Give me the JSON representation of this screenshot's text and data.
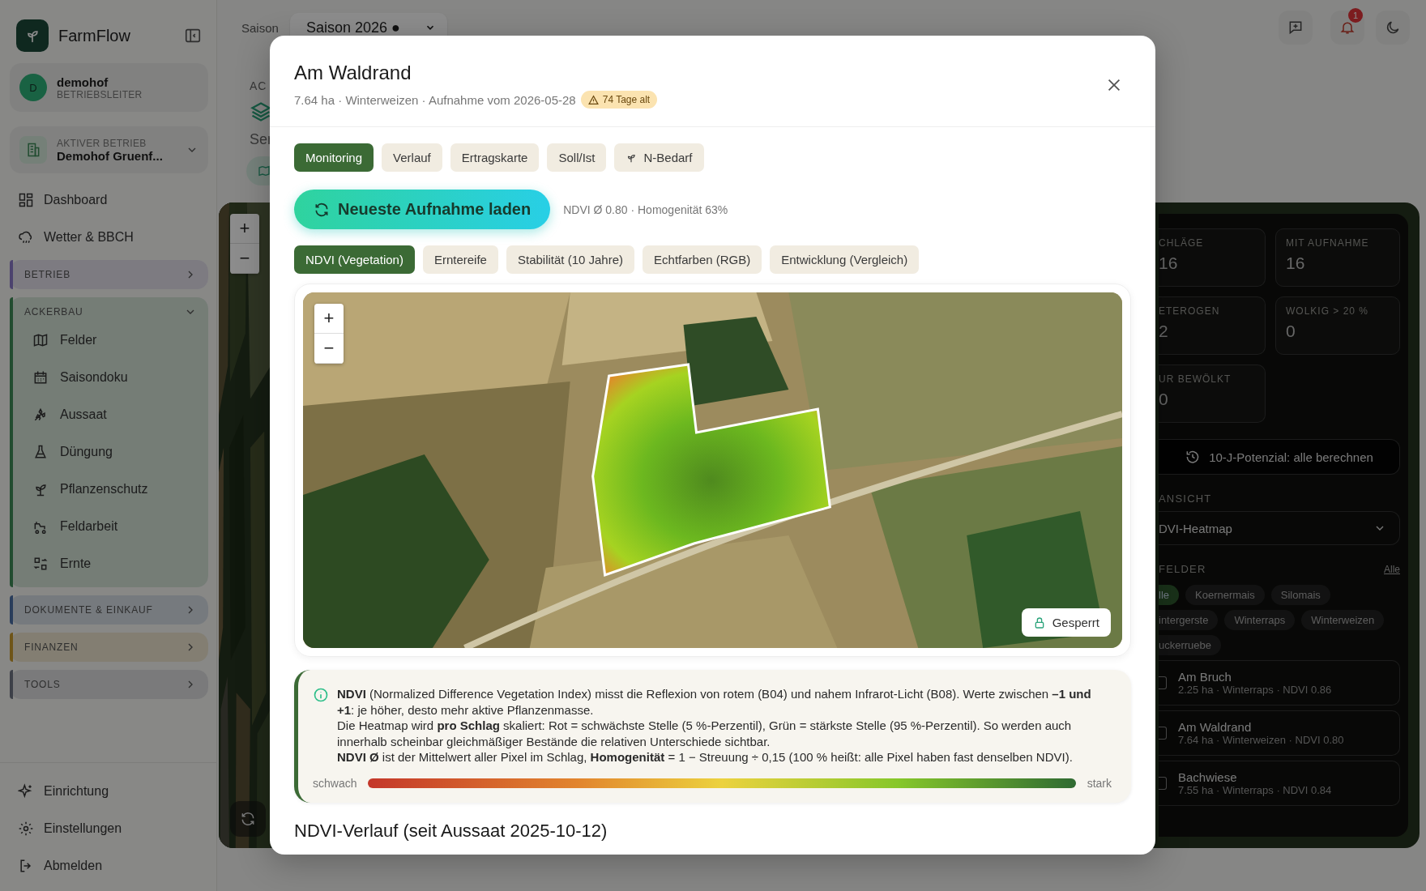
{
  "sidebar": {
    "brand": "FarmFlow",
    "user": {
      "initial": "D",
      "name": "demohof",
      "role": "BETRIEBSLEITER"
    },
    "company": {
      "label": "AKTIVER BETRIEB",
      "name": "Demohof Gruenf..."
    },
    "top_items": [
      {
        "label": "Dashboard"
      },
      {
        "label": "Wetter & BBCH"
      }
    ],
    "groups": [
      {
        "label": "BETRIEB",
        "color": "#4c426e",
        "expanded": false
      },
      {
        "label": "ACKERBAU",
        "color": "#224c30",
        "expanded": true,
        "children": [
          {
            "label": "Felder"
          },
          {
            "label": "Saisondoku"
          },
          {
            "label": "Aussaat"
          },
          {
            "label": "Düngung"
          },
          {
            "label": "Pflanzenschutz"
          },
          {
            "label": "Feldarbeit"
          },
          {
            "label": "Ernte"
          }
        ]
      },
      {
        "label": "DOKUMENTE & EINKAUF",
        "color": "#2a3d5c",
        "expanded": false
      },
      {
        "label": "FINANZEN",
        "color": "#6f5519",
        "expanded": false
      },
      {
        "label": "TOOLS",
        "color": "#3d4148",
        "expanded": false
      }
    ],
    "bottom_items": [
      {
        "label": "Einrichtung"
      },
      {
        "label": "Einstellungen"
      },
      {
        "label": "Abmelden"
      }
    ]
  },
  "topbar": {
    "season_label": "Saison",
    "season_value": "Saison 2026 ●",
    "notification_count": "1"
  },
  "page": {
    "section_label": "AC",
    "subtitle": "Ser"
  },
  "background_map": {
    "zoom_in": "+",
    "zoom_out": "−"
  },
  "map_panel": {
    "stats": [
      {
        "label": "CHLÄGE",
        "value": "16"
      },
      {
        "label": "MIT AUFNAHME",
        "value": "16"
      },
      {
        "label": "ETEROGEN",
        "value": "2"
      },
      {
        "label": "WOLKIG > 20 %",
        "value": "0"
      },
      {
        "label": "UR BEWÖLKT",
        "value": "0"
      }
    ],
    "potential_button": "10-J-Potenzial: alle berechnen",
    "view_label": "ANSICHT",
    "view_value": "DVI-Heatmap",
    "fields_label": "FELDER",
    "all_link": "Alle",
    "chips": [
      {
        "label": "lle",
        "selected": true
      },
      {
        "label": "Koernermais",
        "selected": false
      },
      {
        "label": "Silomais",
        "selected": false
      },
      {
        "label": "intergerste",
        "selected": false
      },
      {
        "label": "Winterraps",
        "selected": false
      },
      {
        "label": "Winterweizen",
        "selected": false
      },
      {
        "label": "uckerruebe",
        "selected": false
      }
    ],
    "fields": [
      {
        "name": "Am Bruch",
        "meta": "2.25 ha · Winterraps · NDVI 0.86",
        "checked": false
      },
      {
        "name": "Am Waldrand",
        "meta": "7.64 ha · Winterweizen · NDVI 0.80",
        "checked": false
      },
      {
        "name": "Bachwiese",
        "meta": "7.55 ha · Winterraps · NDVI 0.84",
        "checked": false
      }
    ]
  },
  "modal": {
    "title": "Am Waldrand",
    "subtitle": "7.64 ha · Winterweizen · Aufnahme vom 2026-05-28",
    "age_badge": "74 Tage alt",
    "tabs": [
      {
        "label": "Monitoring",
        "selected": true
      },
      {
        "label": "Verlauf",
        "selected": false
      },
      {
        "label": "Ertragskarte",
        "selected": false
      },
      {
        "label": "Soll/Ist",
        "selected": false
      },
      {
        "label": "N-Bedarf",
        "selected": false
      }
    ],
    "load_button": "Neueste Aufnahme laden",
    "summary": "NDVI Ø 0.80 · Homogenität 63%",
    "layers": [
      {
        "label": "NDVI (Vegetation)",
        "selected": true
      },
      {
        "label": "Erntereife",
        "selected": false
      },
      {
        "label": "Stabilität (10 Jahre)",
        "selected": false
      },
      {
        "label": "Echtfarben (RGB)",
        "selected": false
      },
      {
        "label": "Entwicklung (Vergleich)",
        "selected": false
      }
    ],
    "map": {
      "kind": "picture",
      "zoom_in": "+",
      "zoom_out": "−",
      "lock_button": "Gesperrt"
    },
    "info": [
      "**NDVI** (Normalized Difference Vegetation Index) misst die Reflexion von rotem (B04) und nahem Infrarot-Licht (B08). Werte zwischen **–1 und +1**: je höher, desto mehr aktive Pflanzenmasse.",
      "Die Heatmap wird **pro Schlag** skaliert: Rot = schwächste Stelle (5 %-Perzentil), Grün = stärkste Stelle (95 %-Perzentil). So werden auch innerhalb scheinbar gleichmäßiger Bestände die relativen Unterschiede sichtbar.",
      "**NDVI Ø** ist der Mittelwert aller Pixel im Schlag, **Homogenität** = 1 − Streuung ÷ 0,15 (100 % heißt: alle Pixel haben fast denselben NDVI)."
    ],
    "legend": {
      "low": "schwach",
      "high": "stark"
    },
    "section_heading": "NDVI-Verlauf (seit Aussaat 2025-10-12)"
  }
}
